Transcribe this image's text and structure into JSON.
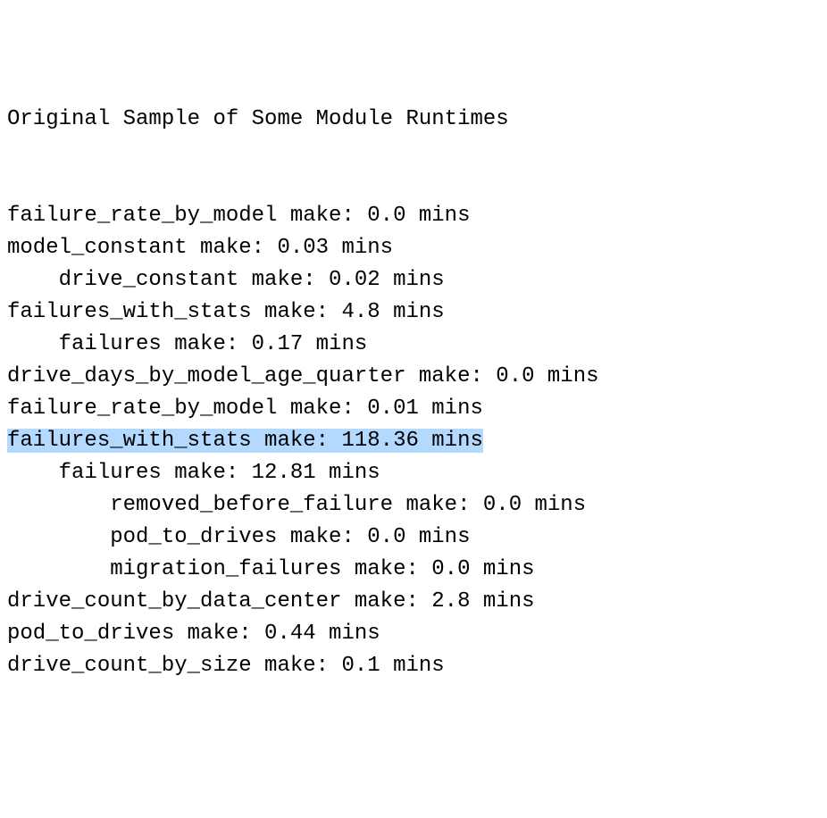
{
  "title": "Original Sample of Some Module Runtimes",
  "lines": [
    {
      "indent": 0,
      "module": "failure_rate_by_model",
      "time": "0.0",
      "highlighted": false
    },
    {
      "indent": 0,
      "module": "model_constant",
      "time": "0.03",
      "highlighted": false
    },
    {
      "indent": 1,
      "module": "drive_constant",
      "time": "0.02",
      "highlighted": false
    },
    {
      "indent": 0,
      "module": "failures_with_stats",
      "time": "4.8",
      "highlighted": false
    },
    {
      "indent": 1,
      "module": "failures",
      "time": "0.17",
      "highlighted": false
    },
    {
      "indent": 0,
      "module": "drive_days_by_model_age_quarter",
      "time": "0.0",
      "highlighted": false
    },
    {
      "indent": 0,
      "module": "failure_rate_by_model",
      "time": "0.01",
      "highlighted": false
    },
    {
      "indent": 0,
      "module": "failures_with_stats",
      "time": "118.36",
      "highlighted": true
    },
    {
      "indent": 1,
      "module": "failures",
      "time": "12.81",
      "highlighted": false
    },
    {
      "indent": 2,
      "module": "removed_before_failure",
      "time": "0.0",
      "highlighted": false
    },
    {
      "indent": 2,
      "module": "pod_to_drives",
      "time": "0.0",
      "highlighted": false
    },
    {
      "indent": 2,
      "module": "migration_failures",
      "time": "0.0",
      "highlighted": false
    },
    {
      "indent": 0,
      "module": "drive_count_by_data_center",
      "time": "2.8",
      "highlighted": false
    },
    {
      "indent": 0,
      "module": "pod_to_drives",
      "time": "0.44",
      "highlighted": false
    },
    {
      "indent": 0,
      "module": "drive_count_by_size",
      "time": "0.1",
      "highlighted": false
    }
  ],
  "suffix": "mins",
  "verb": "make:"
}
